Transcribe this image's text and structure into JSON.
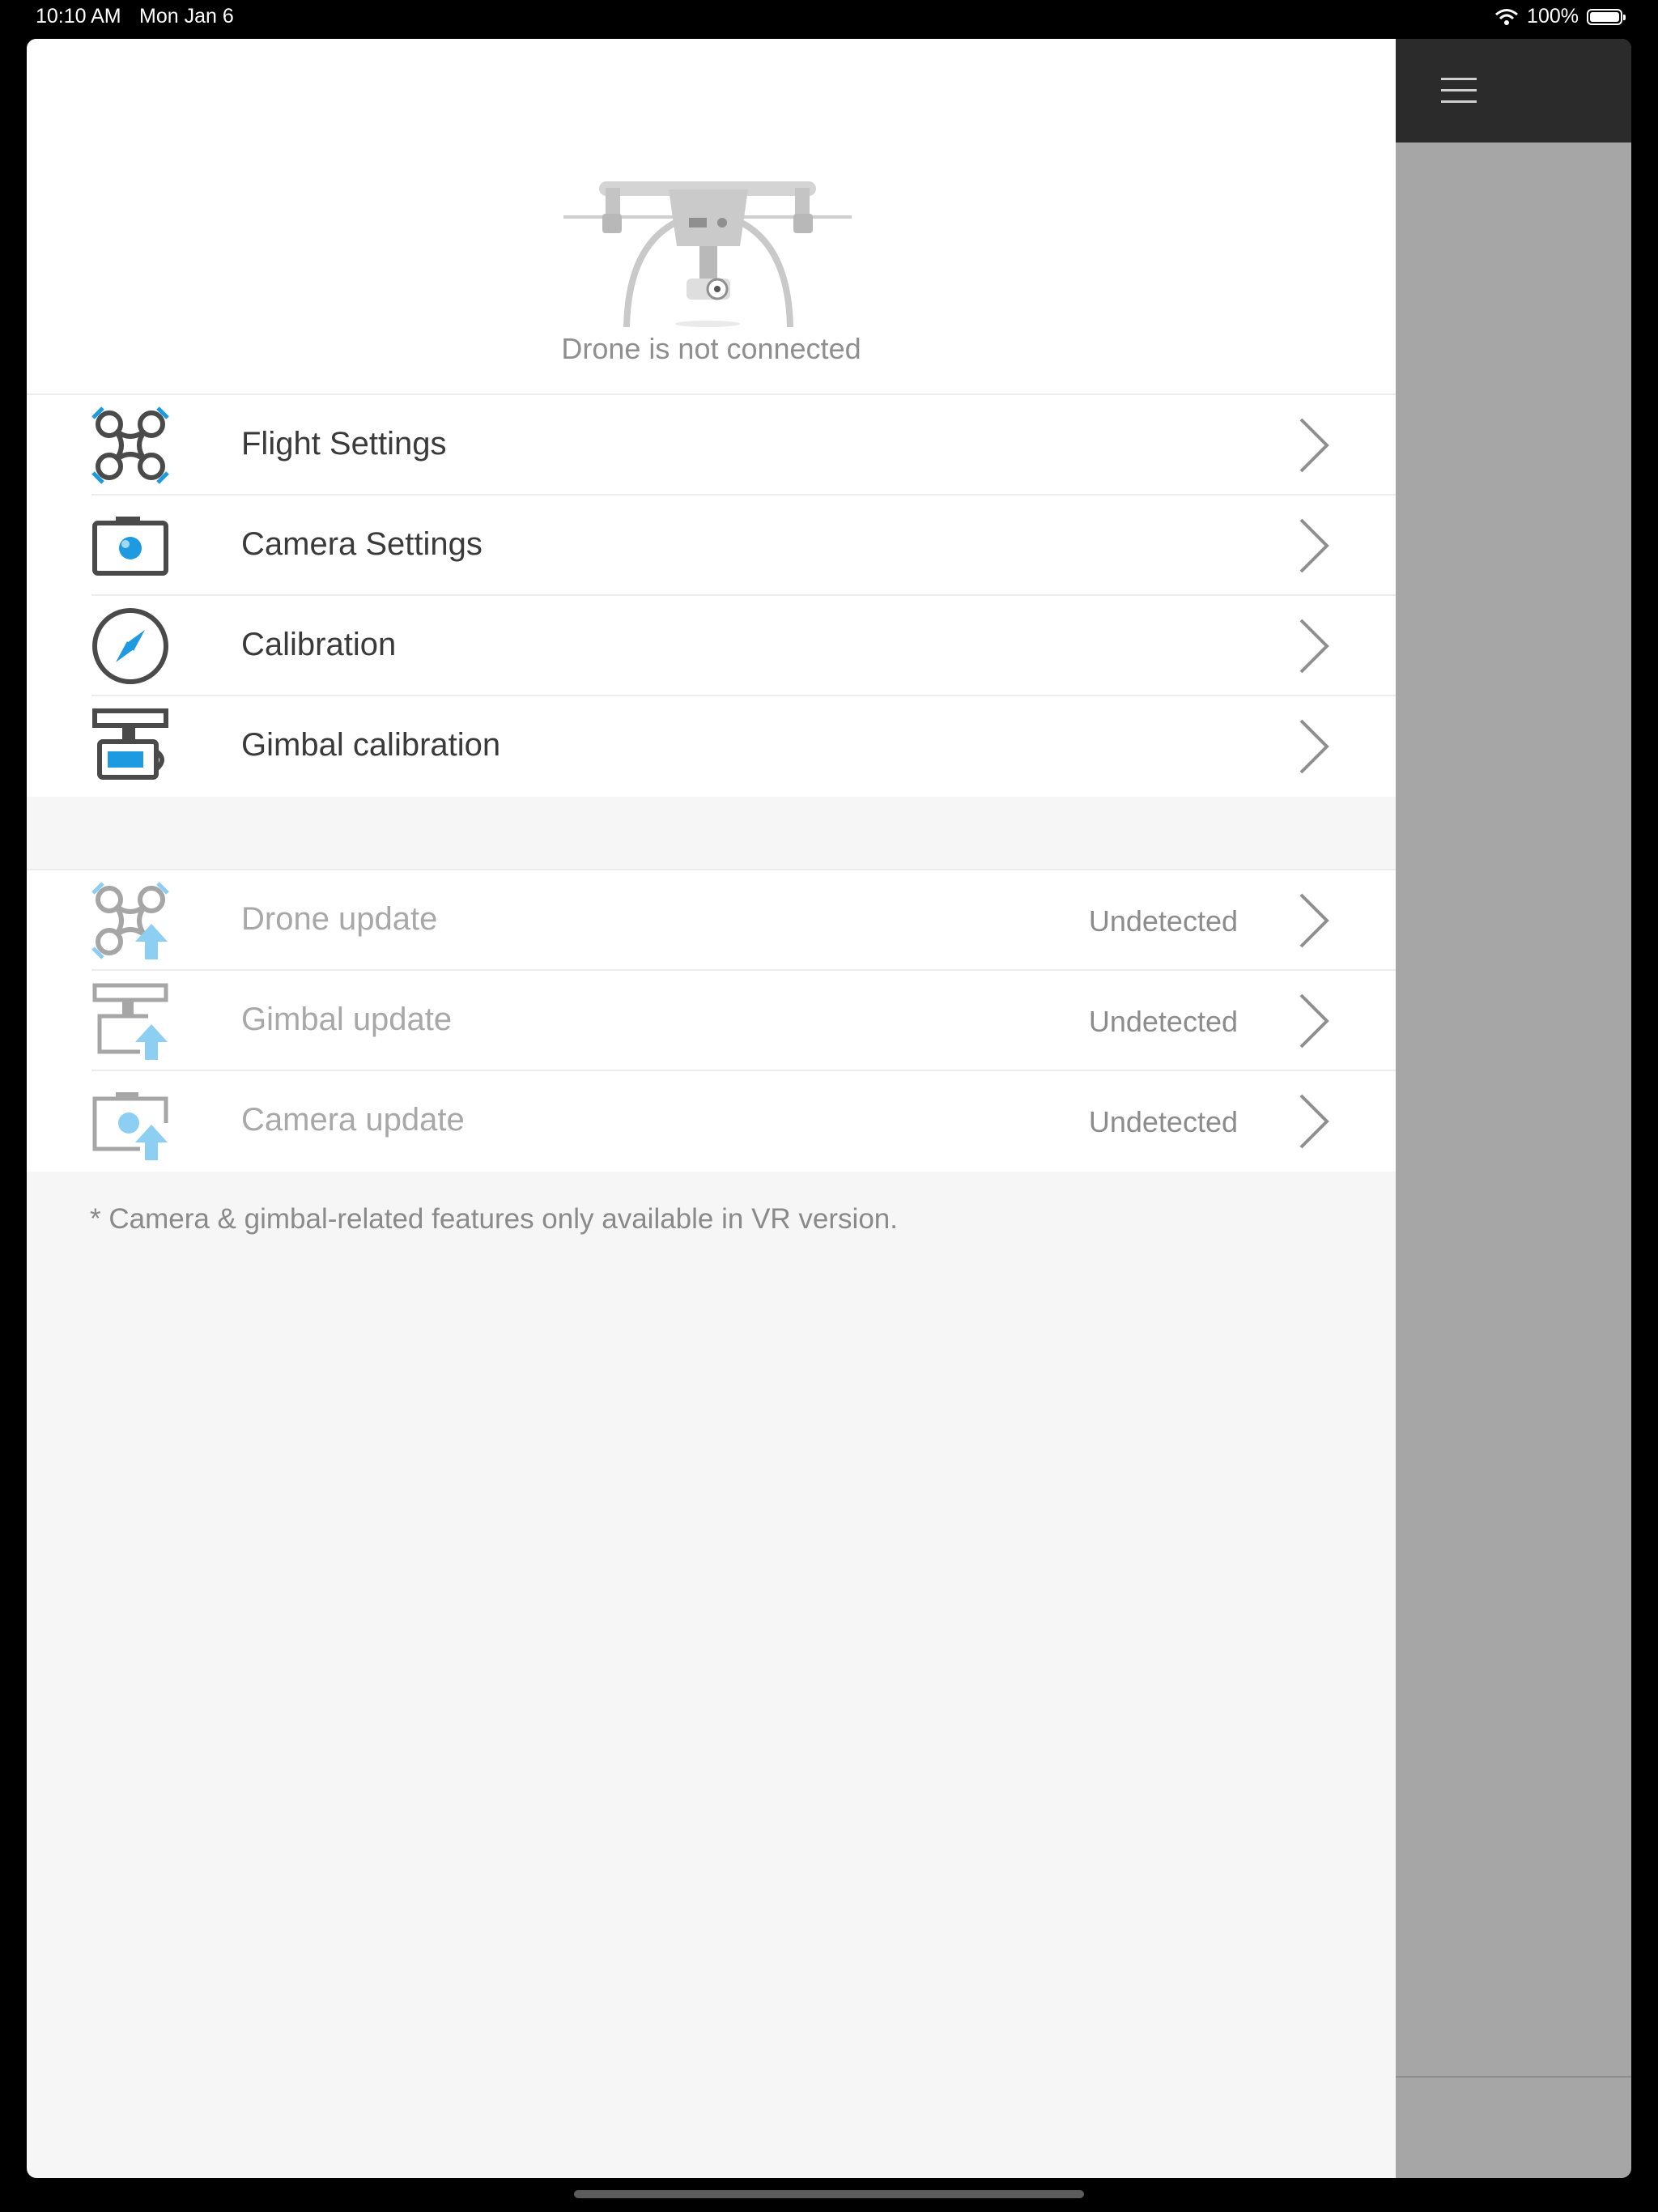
{
  "status_bar": {
    "time": "10:10 AM",
    "date": "Mon Jan 6",
    "battery": "100%",
    "icons": [
      "wifi-icon",
      "battery-icon"
    ]
  },
  "header": {
    "drone_status": "Drone is not connected",
    "menu_icon": "hamburger-menu-icon"
  },
  "settings": [
    {
      "label": "Flight Settings",
      "icon": "drone-icon"
    },
    {
      "label": "Camera Settings",
      "icon": "camera-icon"
    },
    {
      "label": "Calibration",
      "icon": "compass-icon"
    },
    {
      "label": "Gimbal calibration",
      "icon": "gimbal-icon"
    }
  ],
  "updates": [
    {
      "label": "Drone update",
      "status": "Undetected",
      "icon": "drone-update-icon"
    },
    {
      "label": "Gimbal update",
      "status": "Undetected",
      "icon": "gimbal-update-icon"
    },
    {
      "label": "Camera update",
      "status": "Undetected",
      "icon": "camera-update-icon"
    }
  ],
  "footnote": "* Camera & gimbal-related features only available in VR version.",
  "colors": {
    "accent": "#1e9be0",
    "accent_light": "#8dcff2",
    "icon_dark": "#4a4a4a"
  }
}
